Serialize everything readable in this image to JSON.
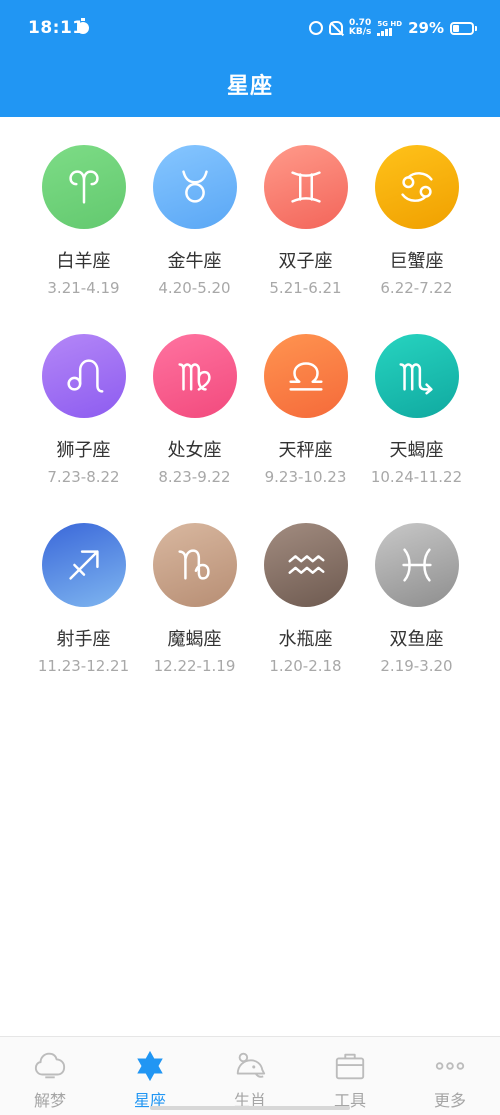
{
  "status_bar": {
    "time": "18:11",
    "net_speed_value": "0.70",
    "net_speed_unit": "KB/s",
    "network_type": "5G HD",
    "battery_percent": "29%",
    "battery_level": 0.29
  },
  "header": {
    "title": "星座"
  },
  "zodiac": [
    {
      "name": "白羊座",
      "dates": "3.21-4.19",
      "icon": "aries-icon",
      "colors": [
        "#7ddc86",
        "#63c96f"
      ]
    },
    {
      "name": "金牛座",
      "dates": "4.20-5.20",
      "icon": "taurus-icon",
      "colors": [
        "#86c6ff",
        "#5aa7f5"
      ]
    },
    {
      "name": "双子座",
      "dates": "5.21-6.21",
      "icon": "gemini-icon",
      "colors": [
        "#ff9a8a",
        "#f3655a"
      ]
    },
    {
      "name": "巨蟹座",
      "dates": "6.22-7.22",
      "icon": "cancer-icon",
      "colors": [
        "#ffc21a",
        "#f0a000"
      ]
    },
    {
      "name": "狮子座",
      "dates": "7.23-8.22",
      "icon": "leo-icon",
      "colors": [
        "#b487f7",
        "#8d5cf0"
      ]
    },
    {
      "name": "处女座",
      "dates": "8.23-9.22",
      "icon": "virgo-icon",
      "colors": [
        "#ff73a0",
        "#f24a7d"
      ]
    },
    {
      "name": "天秤座",
      "dates": "9.23-10.23",
      "icon": "libra-icon",
      "colors": [
        "#ff9450",
        "#f56a3a"
      ]
    },
    {
      "name": "天蝎座",
      "dates": "10.24-11.22",
      "icon": "scorpio-icon",
      "colors": [
        "#27d4c0",
        "#10a9a0"
      ]
    },
    {
      "name": "射手座",
      "dates": "11.23-12.21",
      "icon": "sagittarius-icon",
      "colors": [
        "#3a67d9",
        "#7fb6f0"
      ]
    },
    {
      "name": "魔蝎座",
      "dates": "12.22-1.19",
      "icon": "capricorn-icon",
      "colors": [
        "#d9b8a0",
        "#b78e74"
      ]
    },
    {
      "name": "水瓶座",
      "dates": "1.20-2.18",
      "icon": "aquarius-icon",
      "colors": [
        "#a28c80",
        "#6e5a50"
      ]
    },
    {
      "name": "双鱼座",
      "dates": "2.19-3.20",
      "icon": "pisces-icon",
      "colors": [
        "#c8c8c8",
        "#8e8e8e"
      ]
    }
  ],
  "bottom_nav": [
    {
      "label": "解梦",
      "icon": "cloud-icon",
      "active": false
    },
    {
      "label": "星座",
      "icon": "star-icon",
      "active": true
    },
    {
      "label": "生肖",
      "icon": "mouse-icon",
      "active": false
    },
    {
      "label": "工具",
      "icon": "toolbox-icon",
      "active": false
    },
    {
      "label": "更多",
      "icon": "more-dots-icon",
      "active": false
    }
  ],
  "colors": {
    "brand_blue": "#2196f3",
    "name_text": "#333333",
    "date_text": "#a8a8a8",
    "nav_inactive": "#a5a5a5"
  }
}
